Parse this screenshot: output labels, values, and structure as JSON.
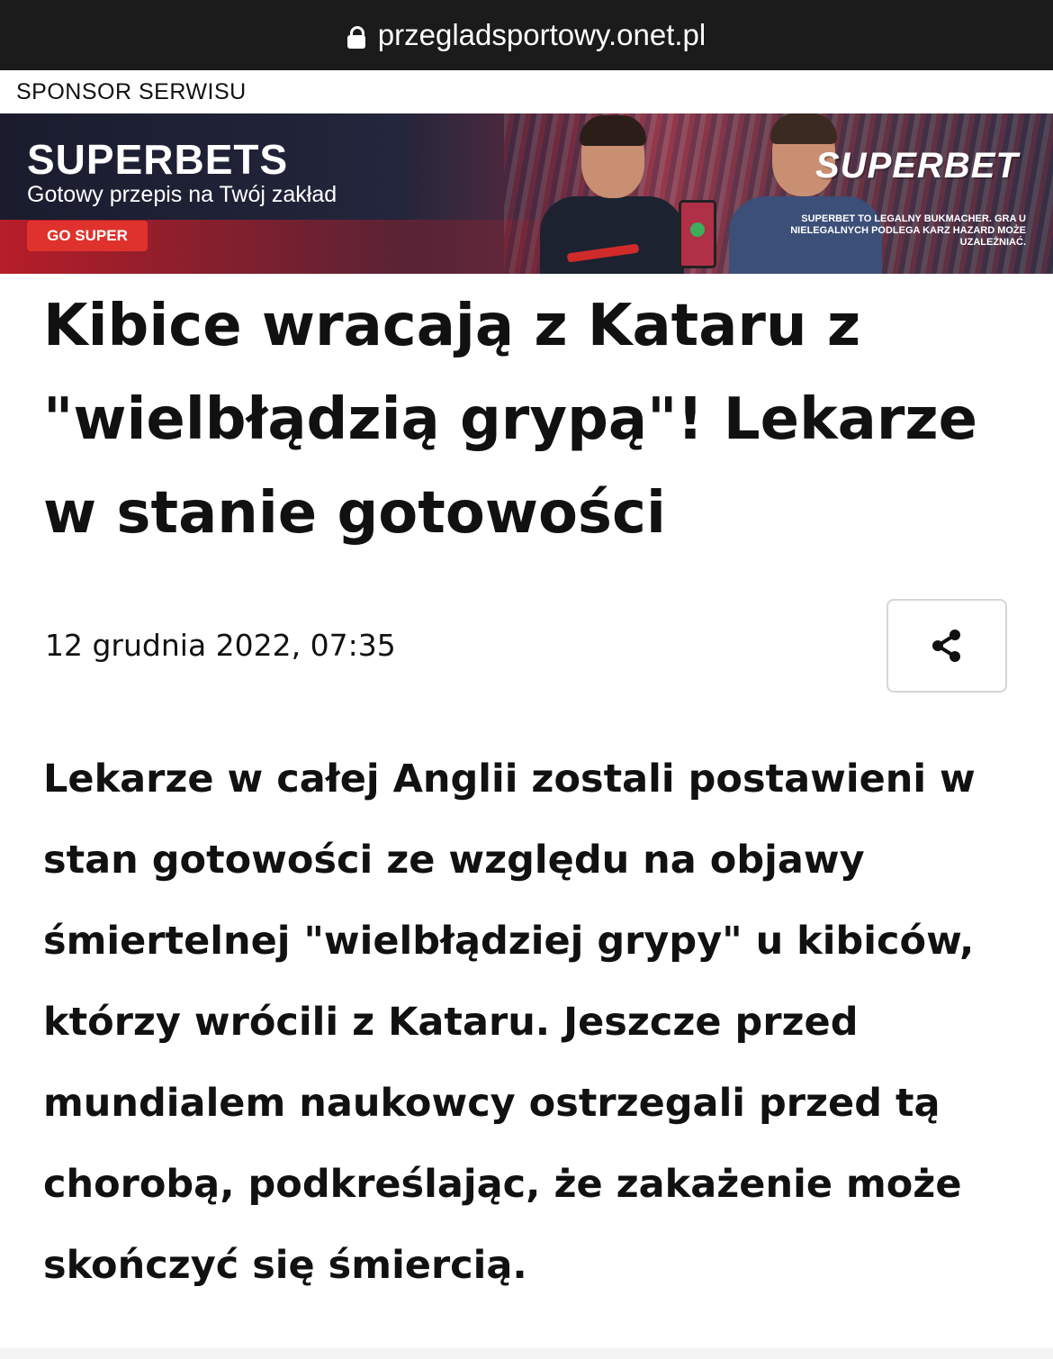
{
  "browser": {
    "url": "przegladsportowy.onet.pl",
    "lock_icon": "lock-icon"
  },
  "sponsor": {
    "label": "SPONSOR SERWISU"
  },
  "ad": {
    "brand": "SUPERBETS",
    "tagline": "Gotowy przepis na Twój zakład",
    "cta": "GO SUPER",
    "logo": "SUPERBET",
    "disclaimer": "SUPERBET TO LEGALNY BUKMACHER. GRA U NIELEGALNYCH PODLEGA KARZ HAZARD MOŻE UZALEŻNIAĆ.",
    "colors": {
      "cta": "#e0322c",
      "dark": "#1a1c2e"
    }
  },
  "article": {
    "headline": "Kibice wracają z Kataru z \"wielbłądzią grypą\"! Lekarze w stanie gotowości",
    "date": "12 grudnia 2022, 07:35",
    "share_icon": "share-icon",
    "lead": "Lekarze w całej Anglii zostali postawieni w stan gotowości ze względu na objawy śmiertelnej \"wielbłądziej grypy\" u kibiców, którzy wrócili z Kataru. Jeszcze przed mundialem naukowcy ostrzegali przed tą chorobą, podkreślając, że zakażenie może skończyć się śmiercią."
  }
}
